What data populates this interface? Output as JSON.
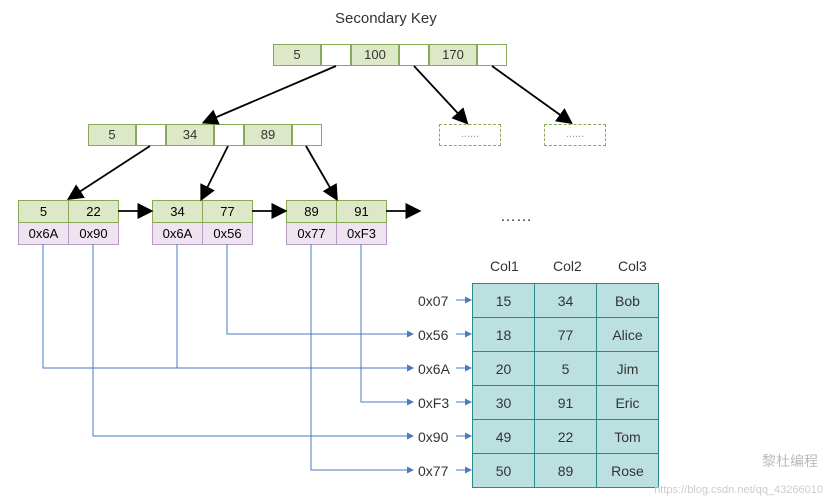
{
  "title": "Secondary Key",
  "root": [
    "5",
    "",
    "100",
    "",
    "170",
    ""
  ],
  "mid": [
    "5",
    "",
    "34",
    "",
    "89",
    ""
  ],
  "dashed_text": "......",
  "leaves": [
    {
      "keys": [
        "5",
        "22"
      ],
      "addrs": [
        "0x6A",
        "0x90"
      ]
    },
    {
      "keys": [
        "34",
        "77"
      ],
      "addrs": [
        "0x6A",
        "0x56"
      ]
    },
    {
      "keys": [
        "89",
        "91"
      ],
      "addrs": [
        "0x77",
        "0xF3"
      ]
    }
  ],
  "dots": "……",
  "addr_labels": [
    "0x07",
    "0x56",
    "0x6A",
    "0xF3",
    "0x90",
    "0x77"
  ],
  "columns": [
    "Col1",
    "Col2",
    "Col3"
  ],
  "rows": [
    [
      "15",
      "34",
      "Bob"
    ],
    [
      "18",
      "77",
      "Alice"
    ],
    [
      "20",
      "5",
      "Jim"
    ],
    [
      "30",
      "91",
      "Eric"
    ],
    [
      "49",
      "22",
      "Tom"
    ],
    [
      "50",
      "89",
      "Rose"
    ]
  ],
  "watermark_text": "https://blog.csdn.net/qq_43266010",
  "wm2_text": "黎杜编程"
}
